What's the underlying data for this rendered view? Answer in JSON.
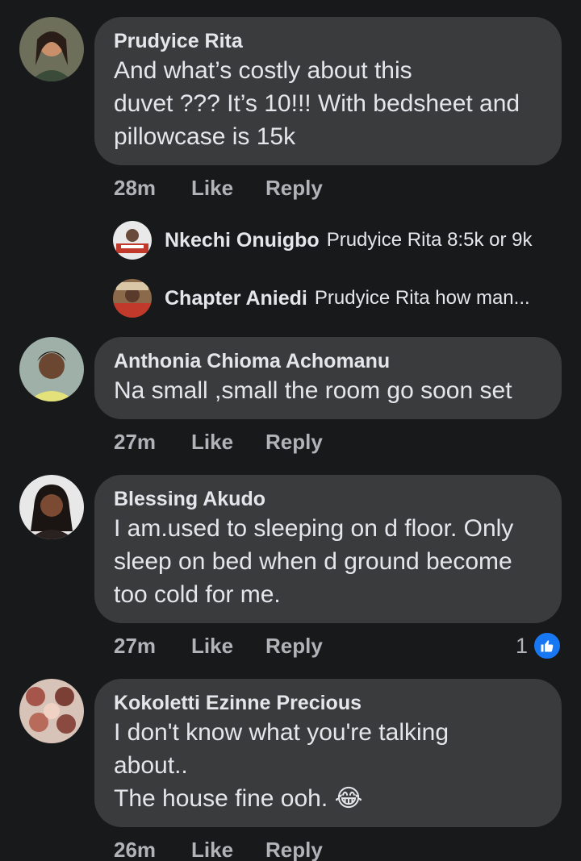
{
  "comments": [
    {
      "author": "Prudyice Rita",
      "text": "And what’s costly about this\nduvet ??? It’s 10!!! With bedsheet and\npillowcase is 15k",
      "time": "28m",
      "like": "Like",
      "reply": "Reply"
    },
    {
      "author": "Anthonia Chioma Achomanu",
      "text": "Na small ,small the room go soon set",
      "time": "27m",
      "like": "Like",
      "reply": "Reply"
    },
    {
      "author": "Blessing Akudo",
      "text": "I am.used to sleeping on d floor. Only\nsleep on bed when d ground become\ntoo cold for me.",
      "time": "27m",
      "like": "Like",
      "reply": "Reply",
      "reaction_count": "1"
    },
    {
      "author": "Kokoletti Ezinne Precious",
      "text": "I don't know what you're talking\nabout..\nThe house fine ooh.",
      "emoji": "😂",
      "time": "26m",
      "like": "Like",
      "reply": "Reply"
    }
  ],
  "replies": [
    {
      "author": "Nkechi Onuigbo",
      "text": "Prudyice Rita 8:5k or 9k"
    },
    {
      "author": "Chapter Aniedi",
      "text": "Prudyice Rita how man..."
    }
  ],
  "colors": {
    "background": "#18191a",
    "bubble": "#3a3b3c",
    "text": "#e4e6eb",
    "secondary": "#b0b3b8",
    "like_blue": "#1877f2"
  },
  "icons": {
    "like_reaction": "thumbs-up-icon",
    "emoji": "laughing-tears-icon"
  }
}
